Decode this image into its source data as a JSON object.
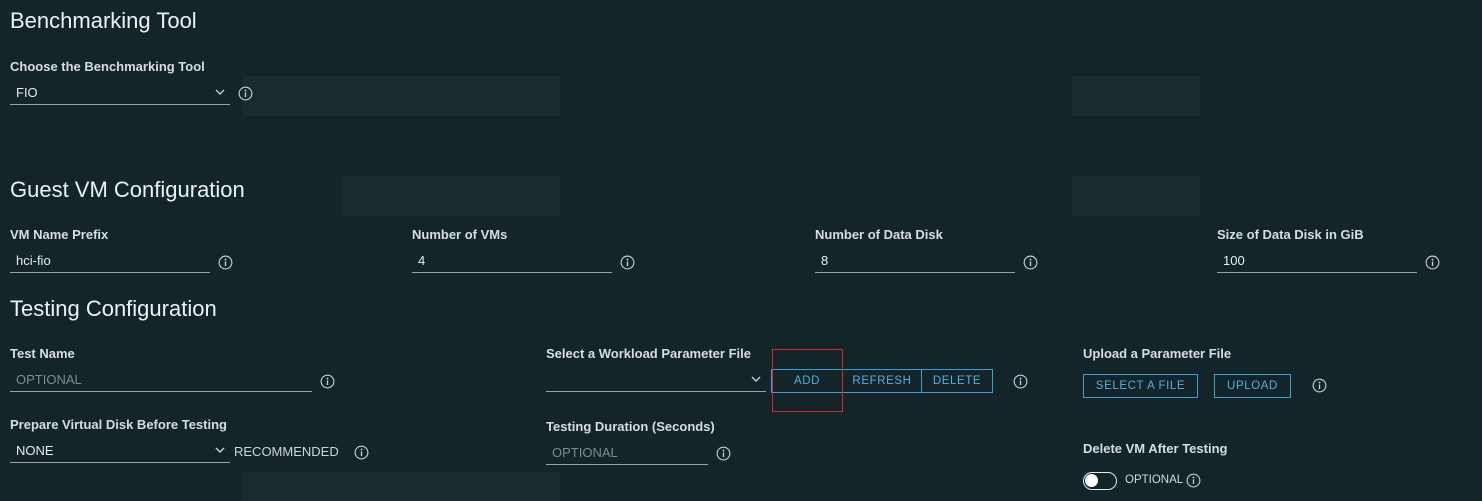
{
  "sections": {
    "benchmarking": "Benchmarking Tool",
    "guest_vm": "Guest VM Configuration",
    "testing": "Testing Configuration"
  },
  "benchmark_tool": {
    "label": "Choose the Benchmarking Tool",
    "value": "FIO"
  },
  "vm": {
    "prefix_label": "VM Name Prefix",
    "prefix_value": "hci-fio",
    "count_label": "Number of VMs",
    "count_value": "4",
    "disk_count_label": "Number of Data Disk",
    "disk_count_value": "8",
    "disk_size_label": "Size of Data Disk in GiB",
    "disk_size_value": "100"
  },
  "testing": {
    "name_label": "Test Name",
    "name_placeholder": "OPTIONAL",
    "workload_label": "Select a Workload Parameter File",
    "workload_value": "",
    "add_label": "ADD",
    "refresh_label": "REFRESH",
    "delete_label": "DELETE",
    "upload_label": "Upload a Parameter File",
    "select_file_label": "SELECT A FILE",
    "upload_button_label": "UPLOAD",
    "prepare_label": "Prepare Virtual Disk Before Testing",
    "prepare_value": "NONE",
    "prepare_hint": "RECOMMENDED",
    "duration_label": "Testing Duration (Seconds)",
    "duration_placeholder": "OPTIONAL",
    "delete_vm_label": "Delete VM After Testing",
    "delete_vm_hint": "OPTIONAL",
    "delete_vm_enabled": false
  },
  "icons": {
    "info": "info-icon",
    "chevron": "chevron-down-icon"
  },
  "colors": {
    "background": "#14252a",
    "accent": "#3aa1d8",
    "highlight": "#e0242b"
  }
}
